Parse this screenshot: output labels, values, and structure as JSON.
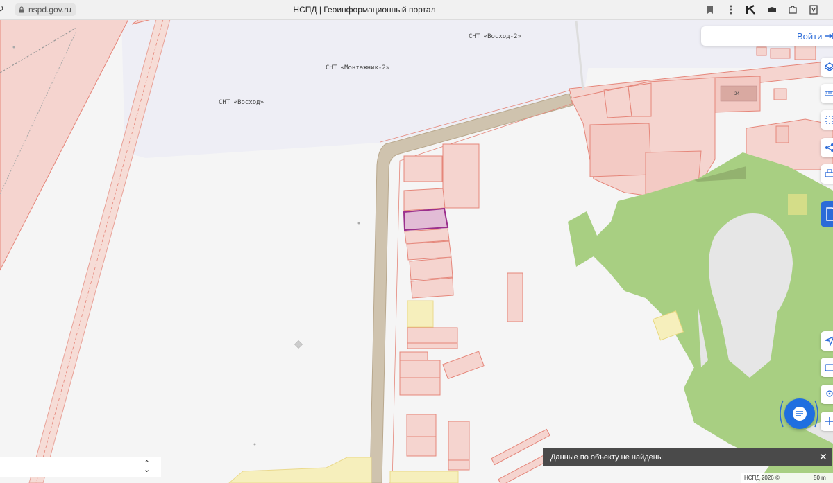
{
  "browser": {
    "url": "nspd.gov.ru",
    "page_title": "НСПД | Геоинформационный портал"
  },
  "header": {
    "login_label": "Войти"
  },
  "map": {
    "labels": {
      "snt_voskhod2": "СНТ «Восход-2»",
      "snt_montazhnik2": "СНТ «Монтажник-2»",
      "snt_voskhod": "СНТ «Восход»",
      "building_number": "24"
    },
    "colors": {
      "parcel_fill": "#f5d4cf",
      "parcel_stroke": "#e5867a",
      "selected_parcel_fill": "#e2bcd6",
      "selected_parcel_stroke": "#9b2f8c",
      "road_fill": "#cfc3ae",
      "green_zone": "#a8cf82",
      "yellow_zone": "#f6efbc",
      "accent_blue": "#2b6bd8"
    }
  },
  "toast": {
    "message": "Данные по объекту не найдены"
  },
  "attribution": {
    "text": "НСПД 2026 ©",
    "scale": "50 m"
  },
  "icons": {
    "toolbar": [
      "layers-icon",
      "ruler-icon",
      "area-select-icon",
      "share-icon",
      "print-icon"
    ],
    "lower_toolbar": [
      "locate-icon",
      "card-icon",
      "pin-icon",
      "zoom-in-icon"
    ]
  }
}
